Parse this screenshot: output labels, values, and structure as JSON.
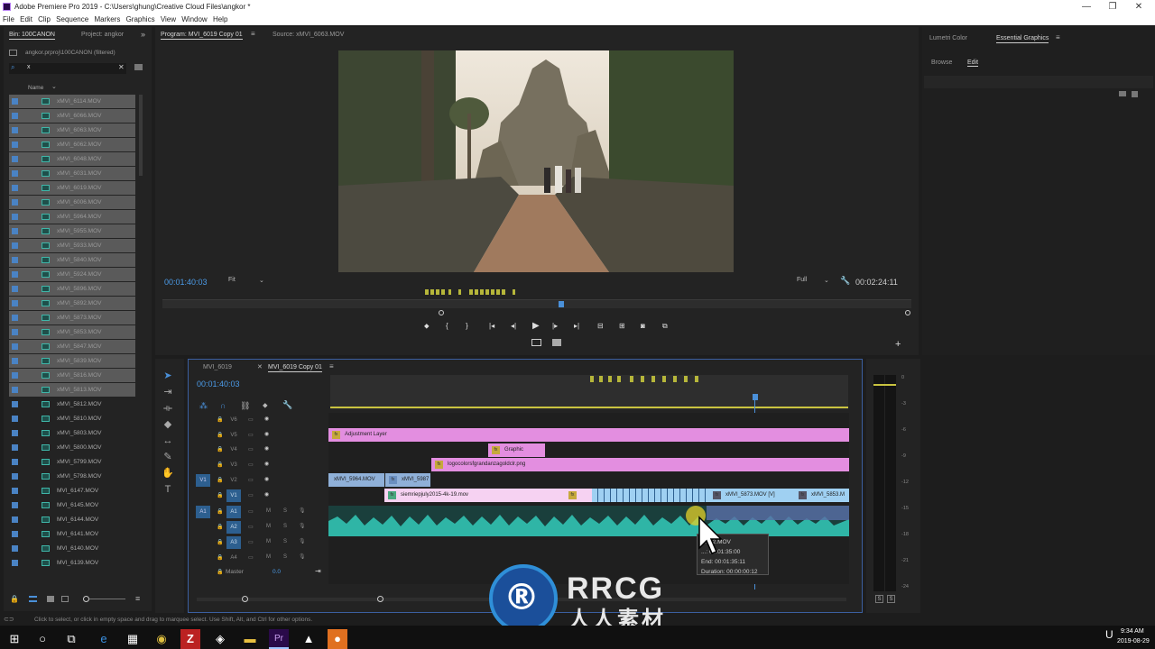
{
  "app": {
    "title": "Adobe Premiere Pro 2019 - C:\\Users\\ghung\\Creative Cloud Files\\angkor *",
    "menus": [
      "File",
      "Edit",
      "Clip",
      "Sequence",
      "Markers",
      "Graphics",
      "View",
      "Window",
      "Help"
    ]
  },
  "project_panel": {
    "tab_bin": "Bin: 100CANON",
    "tab_project": "Project: angkor",
    "path": "angkor.prproj\\100CANON (filtered)",
    "search_value": "x",
    "column_name": "Name",
    "items": [
      {
        "name": "xMVI_6114.MOV",
        "selected": true
      },
      {
        "name": "xMVI_6066.MOV",
        "selected": true
      },
      {
        "name": "xMVI_6063.MOV",
        "selected": true
      },
      {
        "name": "xMVI_6062.MOV",
        "selected": true
      },
      {
        "name": "xMVI_6048.MOV",
        "selected": true
      },
      {
        "name": "xMVI_6031.MOV",
        "selected": true
      },
      {
        "name": "xMVI_6019.MOV",
        "selected": true
      },
      {
        "name": "xMVI_6006.MOV",
        "selected": true
      },
      {
        "name": "xMVI_5964.MOV",
        "selected": true
      },
      {
        "name": "xMVI_5955.MOV",
        "selected": true
      },
      {
        "name": "xMVI_5933.MOV",
        "selected": true
      },
      {
        "name": "xMVI_5840.MOV",
        "selected": true
      },
      {
        "name": "xMVI_5924.MOV",
        "selected": true
      },
      {
        "name": "xMVI_5896.MOV",
        "selected": true
      },
      {
        "name": "xMVI_5892.MOV",
        "selected": true
      },
      {
        "name": "xMVI_5873.MOV",
        "selected": true
      },
      {
        "name": "xMVI_5853.MOV",
        "selected": true
      },
      {
        "name": "xMVI_5847.MOV",
        "selected": true
      },
      {
        "name": "xMVI_5839.MOV",
        "selected": true
      },
      {
        "name": "xMVI_5816.MOV",
        "selected": true
      },
      {
        "name": "xMVI_5813.MOV",
        "selected": true
      },
      {
        "name": "xMVI_5812.MOV",
        "selected": false
      },
      {
        "name": "xMVI_5810.MOV",
        "selected": false
      },
      {
        "name": "xMVI_5803.MOV",
        "selected": false
      },
      {
        "name": "xMVI_5800.MOV",
        "selected": false
      },
      {
        "name": "xMVI_5799.MOV",
        "selected": false
      },
      {
        "name": "xMVI_5798.MOV",
        "selected": false
      },
      {
        "name": "MVI_6147.MOV",
        "selected": false
      },
      {
        "name": "MVI_6145.MOV",
        "selected": false
      },
      {
        "name": "MVI_6144.MOV",
        "selected": false
      },
      {
        "name": "MVI_6141.MOV",
        "selected": false
      },
      {
        "name": "MVI_6140.MOV",
        "selected": false
      },
      {
        "name": "MVI_6139.MOV",
        "selected": false
      }
    ]
  },
  "program_monitor": {
    "tab_program": "Program: MVI_6019 Copy 01",
    "tab_source": "Source: xMVI_6063.MOV",
    "timecode": "00:01:40:03",
    "fit": "Fit",
    "quality": "Full",
    "duration": "00:02:24:11"
  },
  "timeline": {
    "tab1": "MVI_6019",
    "tab2": "MVI_6019 Copy 01",
    "timecode": "00:01:40:03",
    "tracks_video": [
      "V6",
      "V5",
      "V4",
      "V3",
      "V2",
      "V1"
    ],
    "tracks_audio": [
      "A1",
      "A2",
      "A3",
      "A4"
    ],
    "source_v": "V1",
    "source_a": "A1",
    "master_label": "Master",
    "master_value": "0.0",
    "clips": {
      "adjustment": "Adjustment Layer",
      "graphic": "Graphic",
      "logo": "logocolorsfgrandanzagoldclr.png",
      "v2a": "xMVI_5964.MOV",
      "v2b": "xMVI_5987",
      "v1a": "siemriepjuly2015-4k-19.mov",
      "v1b": "xMVI_5873.MOV [V]",
      "v1c": "xMVI_5853.M"
    },
    "tooltip": {
      "name": "...992.MOV",
      "start": "...: 00:01:35:00",
      "end": "End: 00:01:35:11",
      "duration": "Duration: 00:00:00:12"
    }
  },
  "essential_graphics": {
    "tab_lumetri": "Lumetri Color",
    "tab_eg": "Essential Graphics",
    "browse": "Browse",
    "edit": "Edit"
  },
  "meter": {
    "scale": [
      "0",
      "-3",
      "-6",
      "-9",
      "-12",
      "-15",
      "-18",
      "-21",
      "-24"
    ],
    "solo": [
      "S",
      "S"
    ]
  },
  "status_bar": "Click to select, or click in empty space and drag to marquee select. Use Shift, Alt, and Ctrl for other options.",
  "taskbar": {
    "time": "9:34 AM",
    "date": "2019-08-29"
  },
  "watermark": {
    "top": "RRCG",
    "bottom": "人人素材"
  },
  "colors": {
    "accent_blue": "#4a90d9",
    "clip_pink": "#e38ee0",
    "clip_lightblue": "#9fd0f2",
    "clip_audio": "#2fb5a6",
    "timecode_blue": "#4b9be8"
  }
}
